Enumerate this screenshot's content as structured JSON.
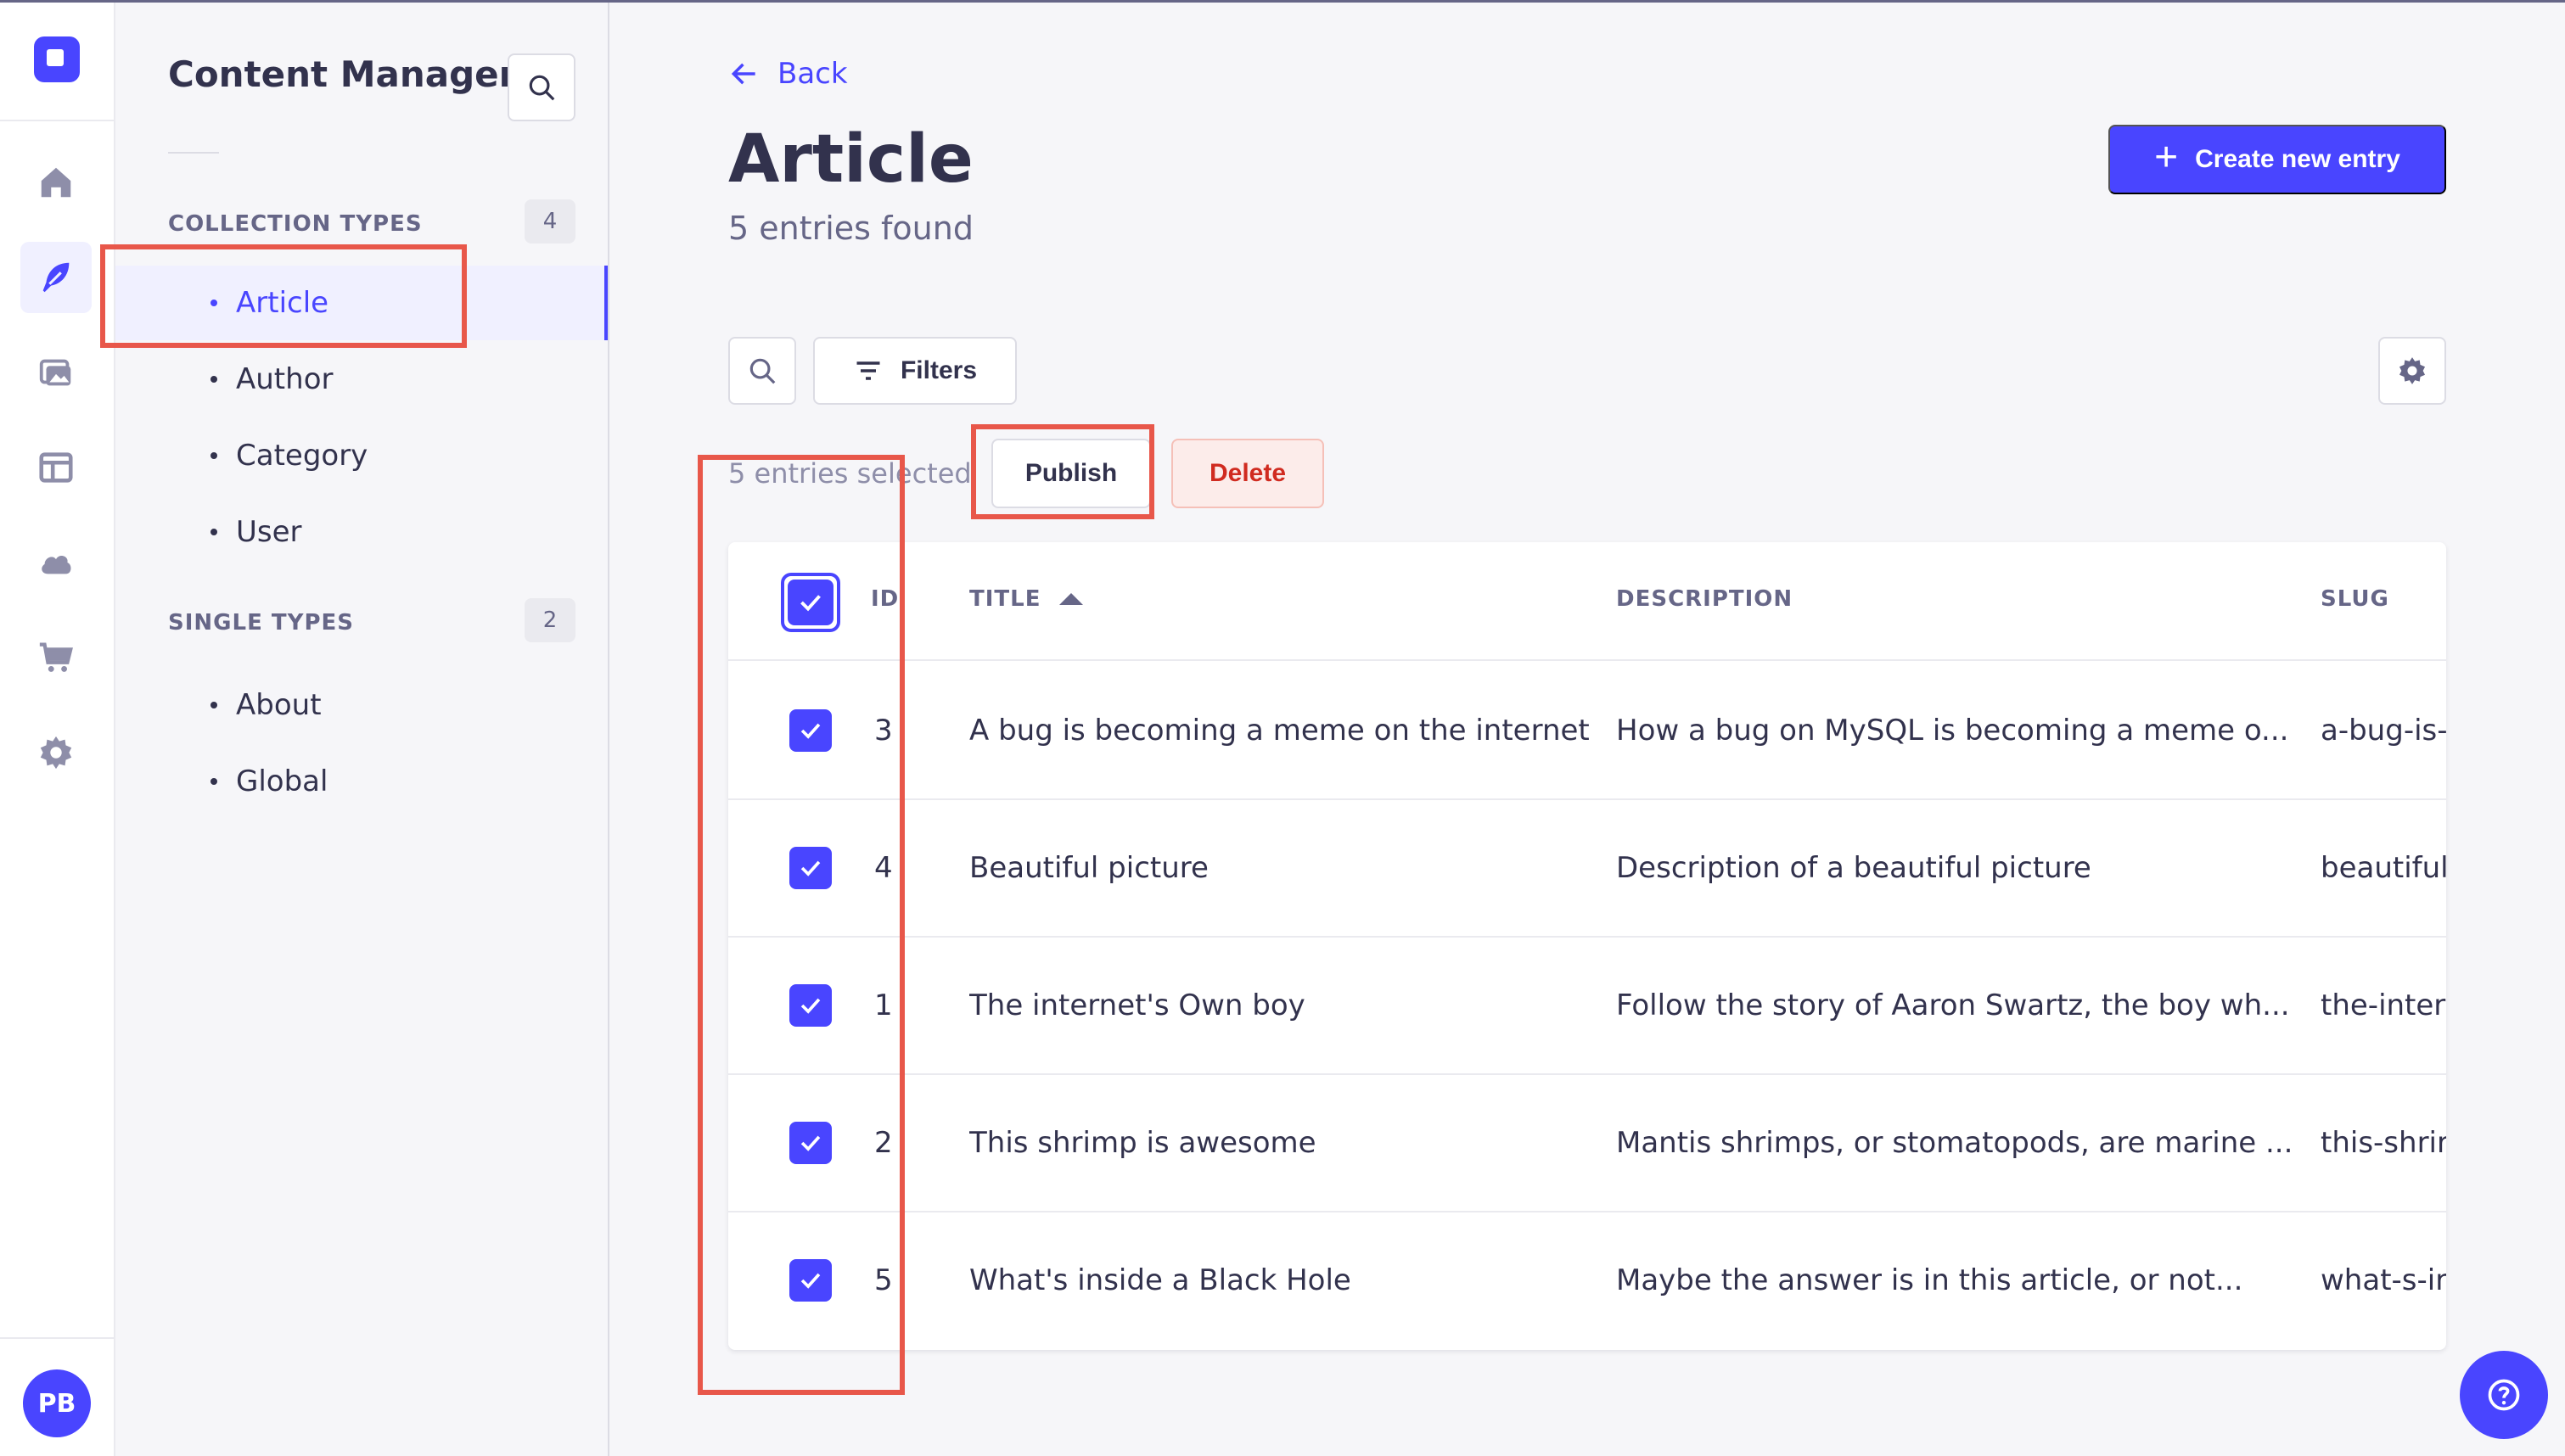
{
  "app": {
    "colors": {
      "primary": "#4945ff",
      "danger": "#d02b20",
      "annotation": "#e8574a"
    }
  },
  "rail": {
    "icons": [
      "home-icon",
      "content-manager-icon",
      "media-library-icon",
      "content-type-builder-icon",
      "cloud-icon",
      "marketplace-icon",
      "settings-icon"
    ],
    "avatar_initials": "PB"
  },
  "subnav": {
    "title": "Content Manager",
    "collection_label": "COLLECTION TYPES",
    "collection_count": "4",
    "collection_items": [
      {
        "label": "Article",
        "active": true
      },
      {
        "label": "Author",
        "active": false
      },
      {
        "label": "Category",
        "active": false
      },
      {
        "label": "User",
        "active": false
      }
    ],
    "single_label": "SINGLE TYPES",
    "single_count": "2",
    "single_items": [
      {
        "label": "About"
      },
      {
        "label": "Global"
      }
    ]
  },
  "header": {
    "back_label": "Back",
    "title": "Article",
    "subtitle": "5 entries found",
    "create_label": "Create new entry"
  },
  "toolbar": {
    "filters_label": "Filters",
    "selected_text": "5 entries selected",
    "publish_label": "Publish",
    "delete_label": "Delete"
  },
  "table": {
    "columns": {
      "id": "ID",
      "title": "TITLE",
      "description": "DESCRIPTION",
      "slug": "SLUG"
    },
    "rows": [
      {
        "id": "3",
        "title": "A bug is becoming a meme on the internet",
        "description": "How a bug on MySQL is becoming a meme o...",
        "slug": "a-bug-is-",
        "checked": true
      },
      {
        "id": "4",
        "title": "Beautiful picture",
        "description": "Description of a beautiful picture",
        "slug": "beautiful-",
        "checked": true
      },
      {
        "id": "1",
        "title": "The internet's Own boy",
        "description": "Follow the story of Aaron Swartz, the boy wh...",
        "slug": "the-interi",
        "checked": true
      },
      {
        "id": "2",
        "title": "This shrimp is awesome",
        "description": "Mantis shrimps, or stomatopods, are marine ...",
        "slug": "this-shrir",
        "checked": true
      },
      {
        "id": "5",
        "title": "What's inside a Black Hole",
        "description": "Maybe the answer is in this article, or not...",
        "slug": "what-s-ir",
        "checked": true
      }
    ]
  }
}
